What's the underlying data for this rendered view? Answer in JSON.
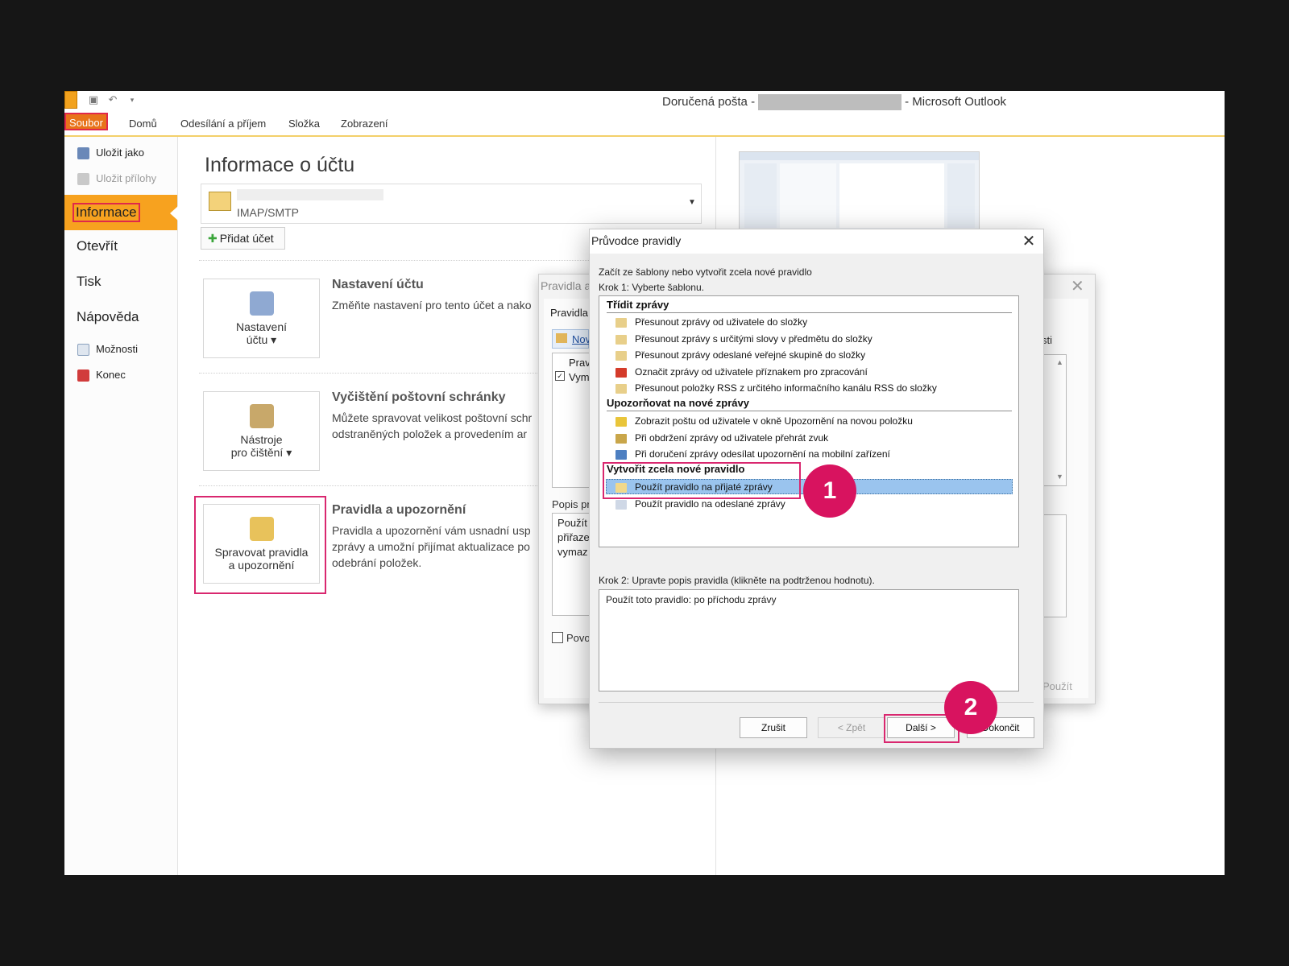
{
  "window": {
    "title_prefix": "Doručená pošta -",
    "title_suffix": "- Microsoft Outlook"
  },
  "ribbon": {
    "tabs": [
      "Soubor",
      "Domů",
      "Odesílání a příjem",
      "Složka",
      "Zobrazení"
    ]
  },
  "backstage": {
    "nav": {
      "save_as": "Uložit jako",
      "save_attachments": "Uložit přílohy",
      "info": "Informace",
      "open": "Otevřít",
      "print": "Tisk",
      "help": "Nápověda",
      "options": "Možnosti",
      "exit": "Konec"
    },
    "title": "Informace o účtu",
    "account": {
      "type": "IMAP/SMTP"
    },
    "add_account": "Přidat účet",
    "sections": [
      {
        "tile_label_1": "Nastavení",
        "tile_label_2": "účtu ▾",
        "title": "Nastavení účtu",
        "desc_1": "Změňte nastavení pro tento účet a nako"
      },
      {
        "tile_label_1": "Nástroje",
        "tile_label_2": "pro čištění ▾",
        "title": "Vyčištění poštovní schránky",
        "desc_1": "Můžete spravovat velikost poštovní schr",
        "desc_2": "odstraněných položek a provedením ar"
      },
      {
        "tile_label_1": "Spravovat pravidla",
        "tile_label_2": "a upozornění",
        "title": "Pravidla a upozornění",
        "desc_1": "Pravidla a upozornění vám usnadní usp",
        "desc_2": "zprávy a umožní přijímat aktualizace po",
        "desc_3": "odebrání položek."
      }
    ]
  },
  "bg_dialog": {
    "title": "Pravidla a",
    "tab": "Pravidla",
    "new_btn": "Nov",
    "col_header": "Prav",
    "row": "Vym",
    "desc_label": "Popis pr",
    "desc_lines": [
      "Použít",
      "přiřaze",
      "vymaz"
    ],
    "checkbox": "Povo",
    "right_label": "sti",
    "apply": "Použít"
  },
  "wizard": {
    "title": "Průvodce pravidly",
    "intro": "Začít ze šablony nebo vytvořit zcela nové pravidlo",
    "step1": "Krok 1: Vyberte šablonu.",
    "groups": [
      {
        "label": "Třídit zprávy",
        "items": [
          "Přesunout zprávy od uživatele do složky",
          "Přesunout zprávy s určitými slovy v předmětu do složky",
          "Přesunout zprávy odeslané veřejné skupině do složky",
          "Označit zprávy od uživatele příznakem pro zpracování",
          "Přesunout položky RSS z určitého informačního kanálu RSS do složky"
        ]
      },
      {
        "label": "Upozorňovat na nové zprávy",
        "items": [
          "Zobrazit poštu od uživatele v okně Upozornění na novou položku",
          "Při obdržení zprávy od uživatele přehrát zvuk",
          "Při doručení zprávy odesílat upozornění na mobilní zařízení"
        ]
      },
      {
        "label": "Vytvořit zcela nové pravidlo",
        "items": [
          "Použít pravidlo na přijaté zprávy",
          "Použít pravidlo na odeslané zprávy"
        ]
      }
    ],
    "selected_item": "Použít pravidlo na přijaté zprávy",
    "step2": "Krok 2: Upravte popis pravidla (klikněte na podtrženou hodnotu).",
    "description": "Použít toto pravidlo: po příchodu zprávy",
    "buttons": {
      "cancel": "Zrušit",
      "back": "< Zpět",
      "next": "Další >",
      "finish": "Dokončit"
    }
  },
  "annotations": {
    "badge_1": "1",
    "badge_2": "2"
  },
  "colors": {
    "accent_orange": "#f7a21f",
    "highlight_pink": "#d9276f",
    "selection_blue": "#9ac4ee"
  }
}
